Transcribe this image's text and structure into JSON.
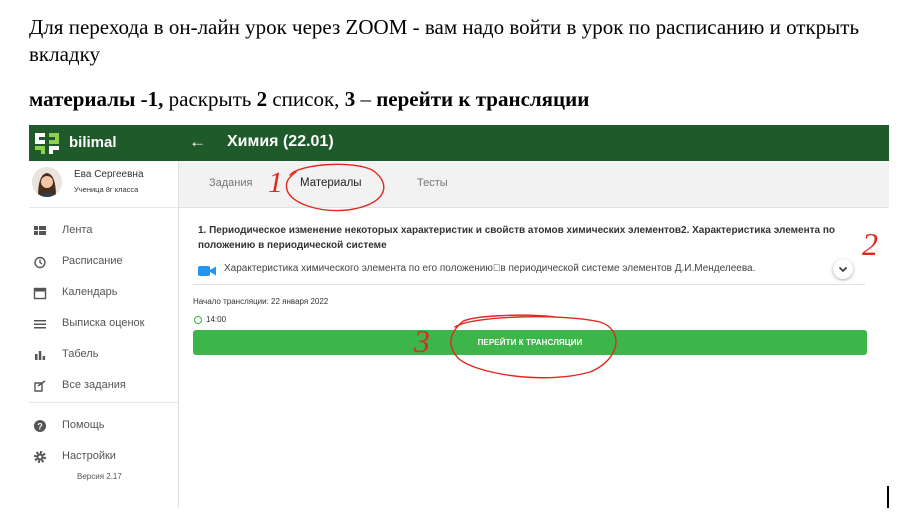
{
  "instructions": {
    "line1": "Для перехода в он-лайн урок через ZOOM  - вам надо войти в урок по расписанию и открыть вкладку",
    "line2_part1": "материалы -1,",
    "line2_part2": " раскрыть ",
    "line2_part3": "2",
    "line2_part4": " список, ",
    "line2_part5": "3",
    "line2_part6": " – ",
    "line2_part7": "перейти к трансляции"
  },
  "app": {
    "brand": "bilimal",
    "back_icon": "arrow-left-icon",
    "course_title": "Химия (22.01)",
    "colors": {
      "topbar": "#1e5a2a",
      "accent": "#3cb54b"
    }
  },
  "profile": {
    "name": "Ева Сергеевна",
    "role": "Ученица 8г класса"
  },
  "sidebar": {
    "items": [
      {
        "label": "Лента",
        "icon": "feed-icon"
      },
      {
        "label": "Расписание",
        "icon": "clock-icon"
      },
      {
        "label": "Календарь",
        "icon": "calendar-icon"
      },
      {
        "label": "Выписка оценок",
        "icon": "list-icon"
      },
      {
        "label": "Табель",
        "icon": "bar-chart-icon"
      },
      {
        "label": "Все задания",
        "icon": "tasks-icon"
      },
      {
        "label": "Помощь",
        "icon": "help-icon"
      },
      {
        "label": "Настройки",
        "icon": "gear-icon"
      }
    ],
    "version": "Версия 2.17"
  },
  "tabs": [
    {
      "label": "Задания",
      "active": false
    },
    {
      "label": "Материалы",
      "active": true
    },
    {
      "label": "Тесты",
      "active": false
    }
  ],
  "material": {
    "title": "1. Периодическое изменение некоторых характеристик и свойств атомов химических элементов2. Характеристика элемента по положению в периодической системе",
    "item": "Характеристика химического элемента по его положению⃞в периодической системе элементов Д.И.Менделеева.",
    "item_icon": "video-camera-icon",
    "expand_icon": "chevron-down-icon"
  },
  "stream": {
    "start_label": "Начало трансляции: 22 января 2022",
    "time": "14:00",
    "join_button": "ПЕРЕЙТИ К ТРАНСЛЯЦИИ"
  },
  "annotations": {
    "mark1": "1",
    "mark2": "2",
    "mark3": "3",
    "color": "#e0281e"
  }
}
